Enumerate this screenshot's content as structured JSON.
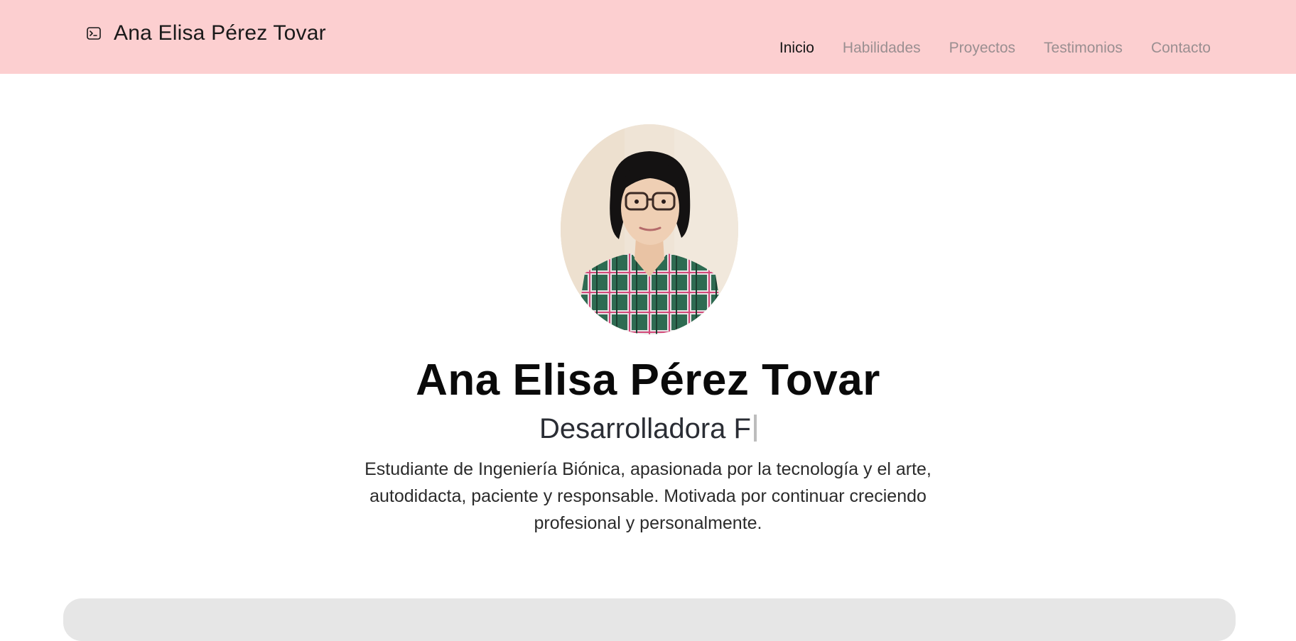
{
  "navbar": {
    "brand_icon": "terminal-icon",
    "brand_name": "Ana Elisa Pérez Tovar",
    "links": [
      {
        "label": "Inicio",
        "active": true
      },
      {
        "label": "Habilidades",
        "active": false
      },
      {
        "label": "Proyectos",
        "active": false
      },
      {
        "label": "Testimonios",
        "active": false
      },
      {
        "label": "Contacto",
        "active": false
      }
    ]
  },
  "hero": {
    "photo_icon": "profile-photo",
    "title": "Ana Elisa Pérez Tovar",
    "role": "Desarrolladora F",
    "bio": "Estudiante de Ingeniería Biónica, apasionada por la tecnología y el arte, autodidacta, paciente y responsable. Motivada por continuar creciendo profesional y personalmente."
  },
  "colors": {
    "navbar_bg": "#fccfd0",
    "nav_inactive": "#9a8f91",
    "nav_active": "#161616",
    "next_section_bg": "#e6e6e6"
  }
}
